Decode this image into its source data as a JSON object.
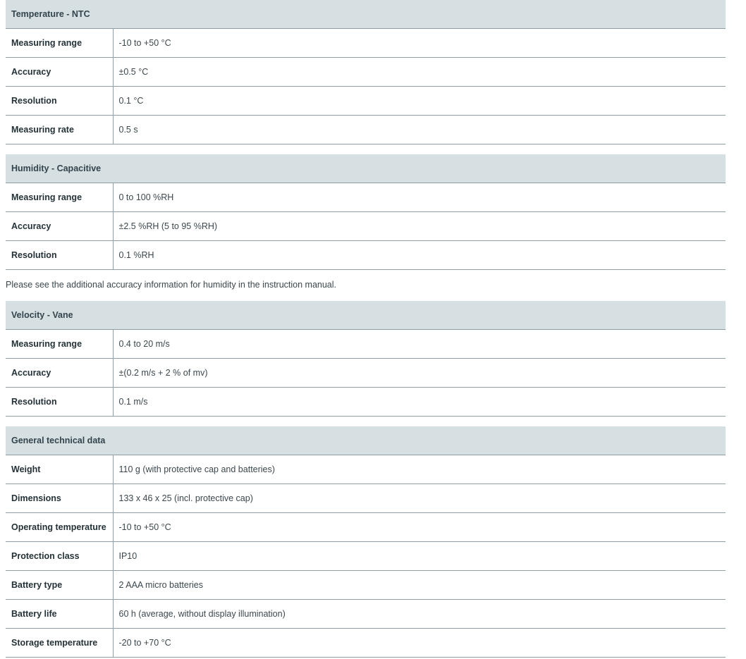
{
  "sections": [
    {
      "title": "Temperature - NTC",
      "rows": [
        {
          "label": "Measuring range",
          "value": "-10 to +50 °C"
        },
        {
          "label": "Accuracy",
          "value": "±0.5 °C"
        },
        {
          "label": "Resolution",
          "value": "0.1 °C"
        },
        {
          "label": "Measuring rate",
          "value": "0.5 s"
        }
      ]
    },
    {
      "title": "Humidity - Capacitive",
      "rows": [
        {
          "label": "Measuring range",
          "value": "0 to 100 %RH"
        },
        {
          "label": "Accuracy",
          "value": "±2.5 %RH (5 to 95 %RH)"
        },
        {
          "label": "Resolution",
          "value": "0.1 %RH"
        }
      ]
    },
    {
      "title": "Velocity - Vane",
      "rows": [
        {
          "label": "Measuring range",
          "value": "0.4 to 20 m/s"
        },
        {
          "label": "Accuracy",
          "value": "±(0.2 m/s + 2 % of mv)"
        },
        {
          "label": "Resolution",
          "value": "0.1 m/s"
        }
      ]
    },
    {
      "title": "General technical data",
      "rows": [
        {
          "label": "Weight",
          "value": "110 g (with protective cap and batteries)"
        },
        {
          "label": "Dimensions",
          "value": "133 x 46 x 25 (incl. protective cap)"
        },
        {
          "label": "Operating temperature",
          "value": "-10 to +50 °C"
        },
        {
          "label": "Protection class",
          "value": "IP10"
        },
        {
          "label": "Battery type",
          "value": "2 AAA micro batteries"
        },
        {
          "label": "Battery life",
          "value": "60 h (average, without display illumination)"
        },
        {
          "label": "Storage temperature",
          "value": "-20 to +70 °C"
        }
      ]
    }
  ],
  "humidity_note": "Please see the additional accuracy information for humidity in the instruction manual."
}
